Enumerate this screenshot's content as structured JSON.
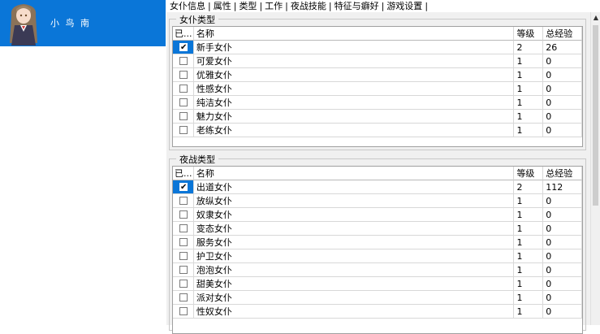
{
  "character": {
    "name": "小 鸟 南"
  },
  "tabs": [
    "女仆信息",
    "属性",
    "类型",
    "工作",
    "夜战技能",
    "特征与癖好",
    "游戏设置"
  ],
  "colors": {
    "accent": "#0a76d8"
  },
  "maid_type": {
    "legend": "女仆类型",
    "columns": [
      "已...",
      "名称",
      "等级",
      "总经验"
    ],
    "rows": [
      {
        "checked": true,
        "name": "新手女仆",
        "level": "2",
        "exp": "26"
      },
      {
        "checked": false,
        "name": "可爱女仆",
        "level": "1",
        "exp": "0"
      },
      {
        "checked": false,
        "name": "优雅女仆",
        "level": "1",
        "exp": "0"
      },
      {
        "checked": false,
        "name": "性感女仆",
        "level": "1",
        "exp": "0"
      },
      {
        "checked": false,
        "name": "纯洁女仆",
        "level": "1",
        "exp": "0"
      },
      {
        "checked": false,
        "name": "魅力女仆",
        "level": "1",
        "exp": "0"
      },
      {
        "checked": false,
        "name": "老练女仆",
        "level": "1",
        "exp": "0"
      }
    ]
  },
  "night_type": {
    "legend": "夜战类型",
    "columns": [
      "已...",
      "名称",
      "等级",
      "总经验"
    ],
    "rows": [
      {
        "checked": true,
        "name": "出道女仆",
        "level": "2",
        "exp": "112"
      },
      {
        "checked": false,
        "name": "放纵女仆",
        "level": "1",
        "exp": "0"
      },
      {
        "checked": false,
        "name": "奴隶女仆",
        "level": "1",
        "exp": "0"
      },
      {
        "checked": false,
        "name": "变态女仆",
        "level": "1",
        "exp": "0"
      },
      {
        "checked": false,
        "name": "服务女仆",
        "level": "1",
        "exp": "0"
      },
      {
        "checked": false,
        "name": "护卫女仆",
        "level": "1",
        "exp": "0"
      },
      {
        "checked": false,
        "name": "泡泡女仆",
        "level": "1",
        "exp": "0"
      },
      {
        "checked": false,
        "name": "甜美女仆",
        "level": "1",
        "exp": "0"
      },
      {
        "checked": false,
        "name": "派对女仆",
        "level": "1",
        "exp": "0"
      },
      {
        "checked": false,
        "name": "性奴女仆",
        "level": "1",
        "exp": "0"
      }
    ]
  },
  "icons": {
    "scroll_up": "up-arrow-icon"
  }
}
